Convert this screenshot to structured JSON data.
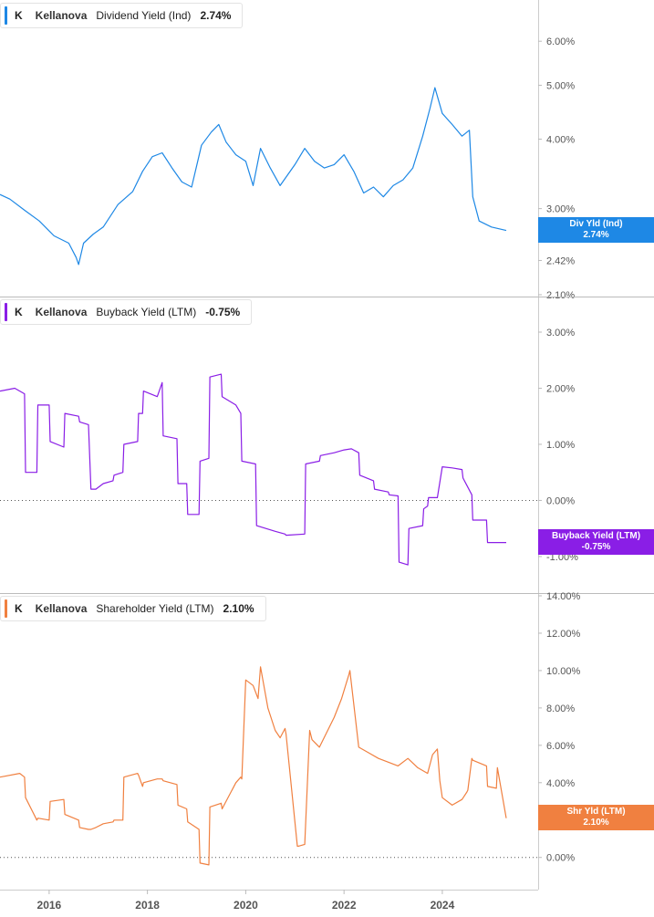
{
  "chart_data": [
    {
      "type": "line",
      "legend": {
        "ticker": "K",
        "company": "Kellanova",
        "metric": "Dividend Yield (Ind)",
        "value": "2.74%"
      },
      "badge": {
        "label": "Div Yld (Ind)",
        "value": "2.74%"
      },
      "color": "#1e88e5",
      "y_scale": "log",
      "ylim": [
        2.1,
        6.5
      ],
      "yticks": [
        6.0,
        5.0,
        4.0,
        3.0,
        2.42,
        2.1
      ],
      "ytick_labels": [
        "6.00%",
        "5.00%",
        "4.00%",
        "3.00%",
        "2.42%",
        "2.10%"
      ],
      "zero_line": false,
      "x": [
        2015.0,
        2015.2,
        2015.5,
        2015.8,
        2016.1,
        2016.4,
        2016.55,
        2016.6,
        2016.7,
        2016.9,
        2017.1,
        2017.4,
        2017.7,
        2017.9,
        2018.1,
        2018.3,
        2018.5,
        2018.7,
        2018.9,
        2019.1,
        2019.3,
        2019.45,
        2019.6,
        2019.8,
        2020.0,
        2020.15,
        2020.3,
        2020.5,
        2020.7,
        2021.0,
        2021.2,
        2021.4,
        2021.6,
        2021.8,
        2022.0,
        2022.2,
        2022.4,
        2022.6,
        2022.8,
        2023.0,
        2023.2,
        2023.4,
        2023.6,
        2023.75,
        2023.85,
        2024.0,
        2024.2,
        2024.4,
        2024.55,
        2024.62,
        2024.75,
        2025.0,
        2025.3
      ],
      "y": [
        3.18,
        3.12,
        2.98,
        2.85,
        2.68,
        2.6,
        2.45,
        2.38,
        2.6,
        2.7,
        2.78,
        3.05,
        3.22,
        3.5,
        3.72,
        3.78,
        3.55,
        3.35,
        3.28,
        3.9,
        4.12,
        4.25,
        3.95,
        3.75,
        3.65,
        3.3,
        3.85,
        3.55,
        3.3,
        3.6,
        3.85,
        3.65,
        3.55,
        3.6,
        3.75,
        3.5,
        3.2,
        3.28,
        3.15,
        3.3,
        3.38,
        3.55,
        4.05,
        4.55,
        4.95,
        4.45,
        4.25,
        4.05,
        4.15,
        3.15,
        2.85,
        2.78,
        2.74
      ],
      "badge_level": 2.74
    },
    {
      "type": "line",
      "legend": {
        "ticker": "K",
        "company": "Kellanova",
        "metric": "Buyback Yield (LTM)",
        "value": "-0.75%"
      },
      "badge": {
        "label": "Buyback Yield (LTM)",
        "value": "-0.75%"
      },
      "color": "#8a1ee6",
      "y_scale": "linear",
      "ylim": [
        -1.05,
        3.0
      ],
      "yticks": [
        3.0,
        2.0,
        1.0,
        0.0,
        -1.0
      ],
      "ytick_labels": [
        "3.00%",
        "2.00%",
        "1.00%",
        "0.00%",
        "-1.00%"
      ],
      "zero_line": true,
      "x": [
        2015.0,
        2015.3,
        2015.5,
        2015.52,
        2015.75,
        2015.77,
        2016.0,
        2016.02,
        2016.3,
        2016.32,
        2016.6,
        2016.62,
        2016.8,
        2016.85,
        2016.95,
        2017.1,
        2017.3,
        2017.32,
        2017.5,
        2017.52,
        2017.8,
        2017.82,
        2017.9,
        2017.92,
        2018.2,
        2018.3,
        2018.32,
        2018.6,
        2018.62,
        2018.8,
        2018.82,
        2019.05,
        2019.07,
        2019.25,
        2019.27,
        2019.5,
        2019.52,
        2019.8,
        2019.9,
        2019.92,
        2020.2,
        2020.22,
        2020.6,
        2020.8,
        2020.82,
        2021.2,
        2021.22,
        2021.5,
        2021.52,
        2021.8,
        2022.0,
        2022.15,
        2022.3,
        2022.32,
        2022.6,
        2022.62,
        2022.9,
        2022.92,
        2023.1,
        2023.12,
        2023.3,
        2023.32,
        2023.6,
        2023.62,
        2023.7,
        2023.72,
        2023.9,
        2024.0,
        2024.2,
        2024.4,
        2024.42,
        2024.6,
        2024.62,
        2024.9,
        2024.92,
        2025.3
      ],
      "y": [
        1.95,
        2.0,
        1.9,
        0.5,
        0.5,
        1.7,
        1.7,
        1.05,
        0.95,
        1.55,
        1.5,
        1.4,
        1.35,
        0.2,
        0.2,
        0.3,
        0.35,
        0.45,
        0.5,
        1.0,
        1.05,
        1.55,
        1.55,
        1.95,
        1.85,
        2.1,
        1.15,
        1.1,
        0.3,
        0.3,
        -0.25,
        -0.25,
        0.7,
        0.75,
        2.2,
        2.25,
        1.85,
        1.7,
        1.55,
        0.7,
        0.65,
        -0.45,
        -0.55,
        -0.6,
        -0.62,
        -0.6,
        0.65,
        0.7,
        0.8,
        0.85,
        0.9,
        0.92,
        0.85,
        0.45,
        0.35,
        0.2,
        0.15,
        0.1,
        0.08,
        -1.1,
        -1.15,
        -0.5,
        -0.45,
        -0.15,
        -0.1,
        0.05,
        0.05,
        0.6,
        0.58,
        0.55,
        0.4,
        0.1,
        -0.35,
        -0.35,
        -0.75,
        -0.75
      ],
      "badge_level": -0.75
    },
    {
      "type": "line",
      "legend": {
        "ticker": "K",
        "company": "Kellanova",
        "metric": "Shareholder Yield (LTM)",
        "value": "2.10%"
      },
      "badge": {
        "label": "Shr Yld (LTM)",
        "value": "2.10%"
      },
      "color": "#f08040",
      "y_scale": "linear",
      "ylim": [
        -0.6,
        14.0
      ],
      "yticks": [
        14.0,
        12.0,
        10.0,
        8.0,
        6.0,
        4.0,
        2.0,
        0.0
      ],
      "ytick_labels": [
        "14.00%",
        "12.00%",
        "10.00%",
        "8.00%",
        "6.00%",
        "4.00%",
        "2.00%",
        "0.00%"
      ],
      "zero_line": true,
      "x": [
        2015.0,
        2015.4,
        2015.5,
        2015.52,
        2015.75,
        2015.77,
        2016.0,
        2016.02,
        2016.3,
        2016.32,
        2016.6,
        2016.62,
        2016.8,
        2016.85,
        2016.95,
        2017.1,
        2017.3,
        2017.32,
        2017.5,
        2017.52,
        2017.8,
        2017.82,
        2017.9,
        2017.92,
        2018.2,
        2018.3,
        2018.32,
        2018.6,
        2018.62,
        2018.8,
        2018.82,
        2019.05,
        2019.07,
        2019.25,
        2019.27,
        2019.5,
        2019.52,
        2019.8,
        2019.9,
        2019.92,
        2020.0,
        2020.15,
        2020.25,
        2020.3,
        2020.45,
        2020.6,
        2020.7,
        2020.8,
        2020.82,
        2021.05,
        2021.07,
        2021.2,
        2021.3,
        2021.35,
        2021.5,
        2021.8,
        2021.95,
        2022.1,
        2022.12,
        2022.3,
        2022.5,
        2022.7,
        2022.9,
        2023.1,
        2023.3,
        2023.5,
        2023.7,
        2023.8,
        2023.9,
        2023.95,
        2024.0,
        2024.2,
        2024.4,
        2024.5,
        2024.52,
        2024.6,
        2024.62,
        2024.9,
        2024.92,
        2025.1,
        2025.12,
        2025.3
      ],
      "y": [
        4.3,
        4.5,
        4.3,
        3.2,
        2.0,
        2.1,
        2.0,
        3.0,
        3.1,
        2.3,
        2.0,
        1.6,
        1.5,
        1.5,
        1.6,
        1.8,
        1.9,
        2.0,
        2.0,
        4.3,
        4.5,
        4.4,
        3.8,
        4.0,
        4.2,
        4.2,
        4.1,
        3.9,
        2.8,
        2.6,
        1.9,
        1.5,
        -0.3,
        -0.4,
        2.7,
        2.9,
        2.6,
        4.0,
        4.3,
        4.2,
        9.5,
        9.2,
        8.5,
        10.2,
        8.0,
        6.8,
        6.4,
        6.9,
        6.6,
        0.6,
        0.6,
        0.7,
        6.8,
        6.3,
        5.9,
        7.5,
        8.5,
        9.8,
        10.0,
        5.9,
        5.6,
        5.3,
        5.1,
        4.9,
        5.3,
        4.8,
        4.5,
        5.5,
        5.8,
        4.1,
        3.2,
        2.8,
        3.1,
        3.5,
        3.6,
        5.3,
        5.2,
        4.9,
        3.8,
        3.7,
        4.8,
        2.1
      ],
      "badge_level": 2.1
    }
  ],
  "x_axis": {
    "ticks": [
      2016,
      2018,
      2020,
      2022,
      2024
    ],
    "labels": [
      "2016",
      "2018",
      "2020",
      "2022",
      "2024"
    ]
  },
  "colors": {
    "grid": "#dddddd",
    "axis_text": "#555555",
    "zero_line": "#555555"
  }
}
